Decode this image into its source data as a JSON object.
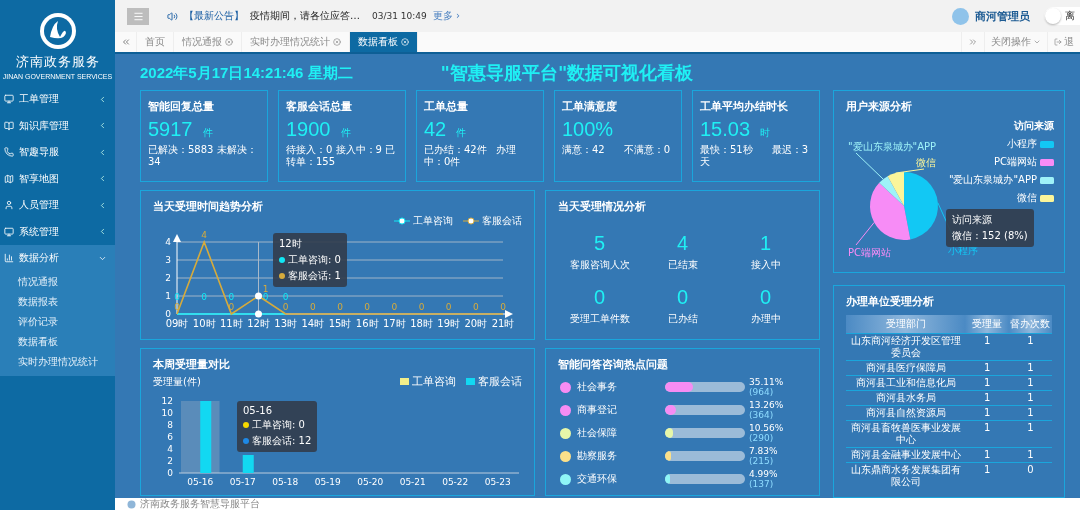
{
  "sidebar": {
    "logo_text": "济南政务服务",
    "logo_subtext": "JINAN GOVERNMENT SERVICES",
    "items": [
      {
        "label": "工单管理",
        "expanded": false
      },
      {
        "label": "知识库管理",
        "expanded": false
      },
      {
        "label": "智趣导服",
        "expanded": false
      },
      {
        "label": "智享地图",
        "expanded": false
      },
      {
        "label": "人员管理",
        "expanded": false
      },
      {
        "label": "系统管理",
        "expanded": false
      },
      {
        "label": "数据分析",
        "expanded": true,
        "children": [
          {
            "label": "情况通报"
          },
          {
            "label": "数据报表"
          },
          {
            "label": "评价记录"
          },
          {
            "label": "数据看板"
          },
          {
            "label": "实时办理情况统计"
          }
        ]
      }
    ]
  },
  "header": {
    "notice_tag": "【最新公告】",
    "notice": "疫情期间，请各位应答…",
    "notice_time": "03/31 10:49",
    "more": "更多 ›",
    "user": "商河管理员",
    "leave": "离"
  },
  "tabs": [
    {
      "label": "首页",
      "closable": false,
      "selected": false
    },
    {
      "label": "情况通报",
      "closable": true,
      "selected": false
    },
    {
      "label": "实时办理情况统计",
      "closable": true,
      "selected": false
    },
    {
      "label": "数据看板",
      "closable": true,
      "selected": true
    }
  ],
  "tab_actions": {
    "close_ops": "关闭操作",
    "logout": "退"
  },
  "dashboard": {
    "datetime": "2022年5月17日14:21:46 星期二",
    "title": "\"智惠导服平台\"数据可视化看板",
    "cards": [
      {
        "title": "智能回复总量",
        "value": "5917",
        "unit": "件",
        "detail": "已解决：5883 未解决：34"
      },
      {
        "title": "客服会话总量",
        "value": "1900",
        "unit": "件",
        "detail": "待接入：0 接入中：9 已转单：155"
      },
      {
        "title": "工单总量",
        "value": "42",
        "unit": "件",
        "detail": "已办结：42件   办理中：0件"
      },
      {
        "title": "工单满意度",
        "value": "100%",
        "detail": "满意：42      不满意：0"
      },
      {
        "title": "工单平均办结时长",
        "value": "15.03",
        "unit": "时",
        "detail": "最快：51秒      最迟：3天"
      }
    ],
    "trend": {
      "title": "当天受理时间趋势分析",
      "tooltip": {
        "title": "12时",
        "lines": [
          "工单咨询: 0",
          "客服会话: 1"
        ]
      },
      "chart_data": {
        "type": "line",
        "categories": [
          "09时",
          "10时",
          "11时",
          "12时",
          "13时",
          "14时",
          "15时",
          "16时",
          "17时",
          "18时",
          "19时",
          "20时",
          "21时"
        ],
        "ylim": [
          0,
          4
        ],
        "yticks": [
          0,
          1,
          2,
          3,
          4
        ],
        "grid": true,
        "data_labels": true,
        "ref_lines": [
          {
            "axis": "x",
            "value": "12时"
          }
        ],
        "series": [
          {
            "name": "工单咨询",
            "color": "#10e8f5",
            "values": [
              0,
              0,
              0,
              0,
              0,
              null,
              null,
              null,
              null,
              null,
              null,
              null,
              null
            ]
          },
          {
            "name": "客服会话",
            "color": "#d6ab3c",
            "values": [
              0,
              4,
              0,
              1,
              0,
              0,
              0,
              0,
              0,
              0,
              0,
              0,
              0
            ]
          }
        ]
      }
    },
    "today": {
      "title": "当天受理情况分析",
      "stats": [
        {
          "value": "5",
          "label": "客服咨询人次"
        },
        {
          "value": "4",
          "label": "已结束"
        },
        {
          "value": "1",
          "label": "接入中"
        },
        {
          "value": "0",
          "label": "受理工单件数"
        },
        {
          "value": "0",
          "label": "已办结"
        },
        {
          "value": "0",
          "label": "办理中"
        }
      ]
    },
    "weekly": {
      "title": "本周受理量对比",
      "tooltip": {
        "title": "05-16",
        "lines": [
          "工单咨询: 0",
          "客服会话: 12"
        ]
      },
      "chart_data": {
        "type": "bar",
        "ylabel": "受理量(件)",
        "categories": [
          "05-16",
          "05-17",
          "05-18",
          "05-19",
          "05-20",
          "05-21",
          "05-22",
          "05-23"
        ],
        "ylim": [
          0,
          12
        ],
        "yticks": [
          0,
          2,
          4,
          6,
          8,
          10,
          12
        ],
        "bands": [
          {
            "axis": "x",
            "from": "05-16",
            "to": "05-16"
          }
        ],
        "series": [
          {
            "name": "工单咨询",
            "color": "#f2ee8a",
            "values": [
              0,
              0,
              0,
              0,
              0,
              0,
              0,
              0
            ]
          },
          {
            "name": "客服会话",
            "color": "#12d8f2",
            "values": [
              12,
              3,
              0,
              0,
              0,
              0,
              0,
              0
            ]
          }
        ]
      }
    },
    "hot": {
      "title": "智能问答咨询热点问题",
      "items": [
        {
          "label": "社会事务",
          "color": "#f68cf3",
          "level": 0.3511,
          "percent": "35.11%",
          "count": "(964)"
        },
        {
          "label": "商事登记",
          "color": "#f68cf3",
          "level": 0.1326,
          "percent": "13.26%",
          "count": "(364)"
        },
        {
          "label": "社会保障",
          "color": "#e6f7a9",
          "level": 0.1056,
          "percent": "10.56%",
          "count": "(290)"
        },
        {
          "label": "勘察服务",
          "color": "#fbe08a",
          "level": 0.0783,
          "percent": "7.83%",
          "count": "(215)"
        },
        {
          "label": "交通环保",
          "color": "#8ff6f6",
          "level": 0.0499,
          "percent": "4.99%",
          "count": "(137)"
        }
      ]
    },
    "source": {
      "title": "用户来源分析",
      "legend_title": "访问来源",
      "legend": [
        {
          "label": "小程序",
          "color": "#12c8f4"
        },
        {
          "label": "PC端网站",
          "color": "#f78cf6"
        },
        {
          "label": "\"爱山东泉城办\"APP",
          "color": "#9ef2f8"
        },
        {
          "label": "微信",
          "color": "#fbf59a"
        }
      ],
      "tooltip": {
        "title": "访问来源",
        "line": "微信 : 152 (8%)"
      },
      "chart_data": {
        "type": "pie",
        "categories": [
          "小程序",
          "PC端网站",
          "\"爱山东泉城办\"APP",
          "微信"
        ],
        "values": [
          47,
          40,
          5,
          8
        ]
      }
    },
    "units": {
      "title": "办理单位受理分析",
      "columns": [
        "受理部门",
        "受理量",
        "督办次数"
      ],
      "rows": [
        [
          "山东商河经济开发区管理委员会",
          "1",
          "1"
        ],
        [
          "商河县医疗保障局",
          "1",
          "1"
        ],
        [
          "商河县工业和信息化局",
          "1",
          "1"
        ],
        [
          "商河县水务局",
          "1",
          "1"
        ],
        [
          "商河县自然资源局",
          "1",
          "1"
        ],
        [
          "商河县畜牧兽医事业发展中心",
          "1",
          "1"
        ],
        [
          "商河县金融事业发展中心",
          "1",
          "1"
        ],
        [
          "山东鼎商水务发展集团有限公司",
          "1",
          "0"
        ]
      ]
    }
  },
  "footer": "济南政务服务智慧导服平台"
}
